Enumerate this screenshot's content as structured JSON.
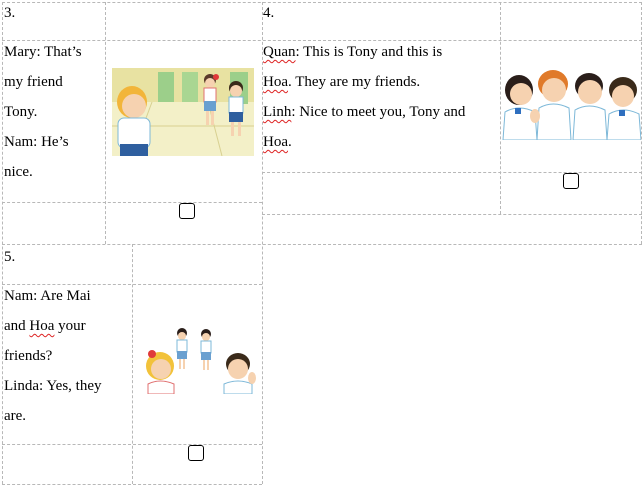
{
  "items": [
    {
      "number": "3.",
      "dialogue": [
        "Mary: That’s",
        "my friend",
        "Tony.",
        "Nam: He’s",
        "nice."
      ],
      "image": "two-boys-talking-classroom-illustration",
      "checkbox_icon": "empty-checkbox-icon"
    },
    {
      "number": "4.",
      "dialogue_parts": {
        "line1_name": "Quan",
        "line1_rest": ": This is Tony and this is",
        "line2_name": "Hoa",
        "line2_rest": ". They are my friends.",
        "line3_name": "Linh",
        "line3_rest": ": Nice to meet you, Tony and",
        "line4_name": "Hoa",
        "line4_rest": "."
      },
      "image": "four-children-waving-illustration",
      "checkbox_icon": "empty-checkbox-icon"
    },
    {
      "number": "5.",
      "dialogue_parts": {
        "line1": "Nam: Are Mai",
        "line2_pre": "and ",
        "line2_name": "Hoa",
        "line2_post": " your",
        "line3": "friends?",
        "line4": "Linda: Yes, they",
        "line5": "are."
      },
      "image": "girls-and-boy-greeting-illustration",
      "checkbox_icon": "empty-checkbox-icon"
    }
  ]
}
